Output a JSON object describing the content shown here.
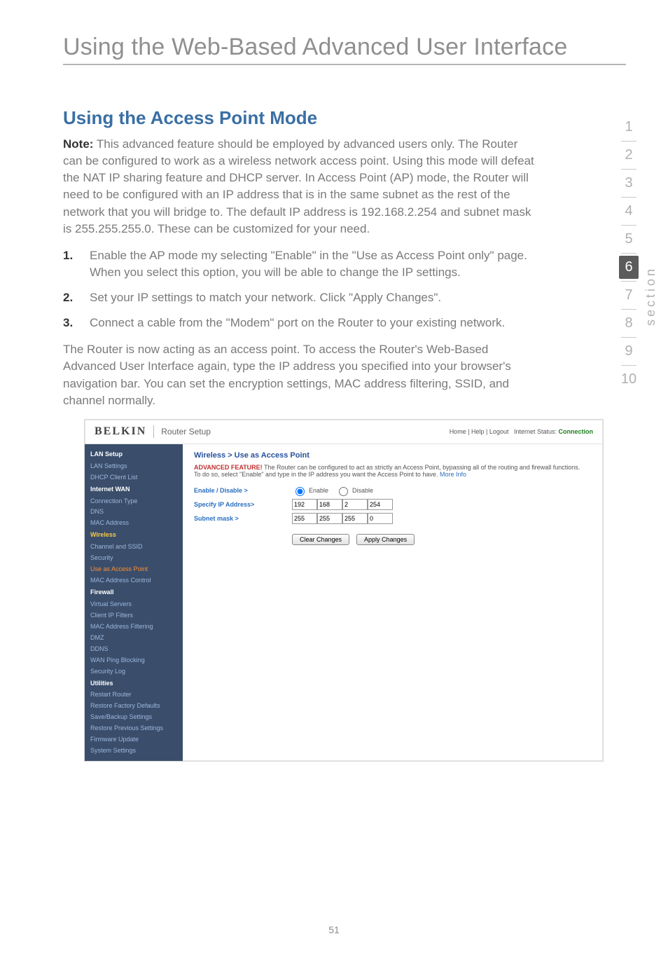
{
  "chapter_title": "Using the Web-Based Advanced User Interface",
  "side_section_label": "section",
  "side_nav": {
    "items": [
      "1",
      "2",
      "3",
      "4",
      "5",
      "6",
      "7",
      "8",
      "9",
      "10"
    ],
    "current_index": 5
  },
  "page_number": "51",
  "section_title": "Using the Access Point Mode",
  "note_label": "Note:",
  "note_body": "This advanced feature should be employed by advanced users only. The Router can be configured to work as a wireless network access point. Using this mode will defeat the NAT IP sharing feature and DHCP server. In Access Point (AP) mode, the Router will need to be configured with an IP address that is in the same subnet as the rest of the network that you will bridge to. The default IP address is 192.168.2.254 and subnet mask is 255.255.255.0. These can be customized for your need.",
  "steps": [
    {
      "num": "1.",
      "text": "Enable the AP mode my selecting \"Enable\" in the \"Use as Access Point only\" page. When you select this option, you will be able to change the IP settings."
    },
    {
      "num": "2.",
      "text": "Set your IP settings to match your network. Click \"Apply Changes\"."
    },
    {
      "num": "3.",
      "text": "Connect a cable from the \"Modem\" port on the Router to your existing network."
    }
  ],
  "after_steps": "The Router is now acting as an access point. To access the Router's Web-Based Advanced User Interface again, type the IP address you specified into your browser's navigation bar. You can set the encryption settings, MAC address filtering, SSID, and channel normally.",
  "router": {
    "logo": "BELKIN",
    "title": "Router Setup",
    "toplinks": {
      "left": "Home | Help | Logout",
      "status_label": "Internet Status:",
      "status_value": "Connection"
    },
    "nav": {
      "groups": [
        {
          "heading": "LAN Setup",
          "items": [
            "LAN Settings",
            "DHCP Client List"
          ]
        },
        {
          "heading": "Internet WAN",
          "items": [
            "Connection Type",
            "DNS",
            "MAC Address"
          ]
        },
        {
          "heading_class": "y",
          "heading": "Wireless",
          "items": [
            "Channel and SSID",
            "Security",
            "Use as Access Point",
            "MAC Address Control"
          ],
          "current_item_index": 2
        },
        {
          "heading": "Firewall",
          "items": [
            "Virtual Servers",
            "Client IP Filters",
            "MAC Address Filtering",
            "DMZ",
            "DDNS",
            "WAN Ping Blocking",
            "Security Log"
          ]
        },
        {
          "heading": "Utilities",
          "items": [
            "Restart Router",
            "Restore Factory Defaults",
            "Save/Backup Settings",
            "Restore Previous Settings",
            "Firmware Update",
            "System Settings"
          ]
        }
      ]
    },
    "main": {
      "crumb": "Wireless > Use as Access Point",
      "warn_label": "ADVANCED FEATURE!",
      "warn_text": "The Router can be configured to act as strictly an Access Point, bypassing all of the routing and firewall functions. To do so, select \"Enable\" and type in the IP address you want the Access Point to have.",
      "warn_more": "More Info",
      "rows": {
        "enable": {
          "label": "Enable / Disable >",
          "opt_enable": "Enable",
          "opt_disable": "Disable",
          "selected": "enable"
        },
        "ip": {
          "label": "Specify IP Address>",
          "o1": "192",
          "o2": "168",
          "o3": "2",
          "o4": "254"
        },
        "mask": {
          "label": "Subnet mask >",
          "o1": "255",
          "o2": "255",
          "o3": "255",
          "o4": "0"
        }
      },
      "buttons": {
        "clear": "Clear Changes",
        "apply": "Apply Changes"
      }
    }
  }
}
